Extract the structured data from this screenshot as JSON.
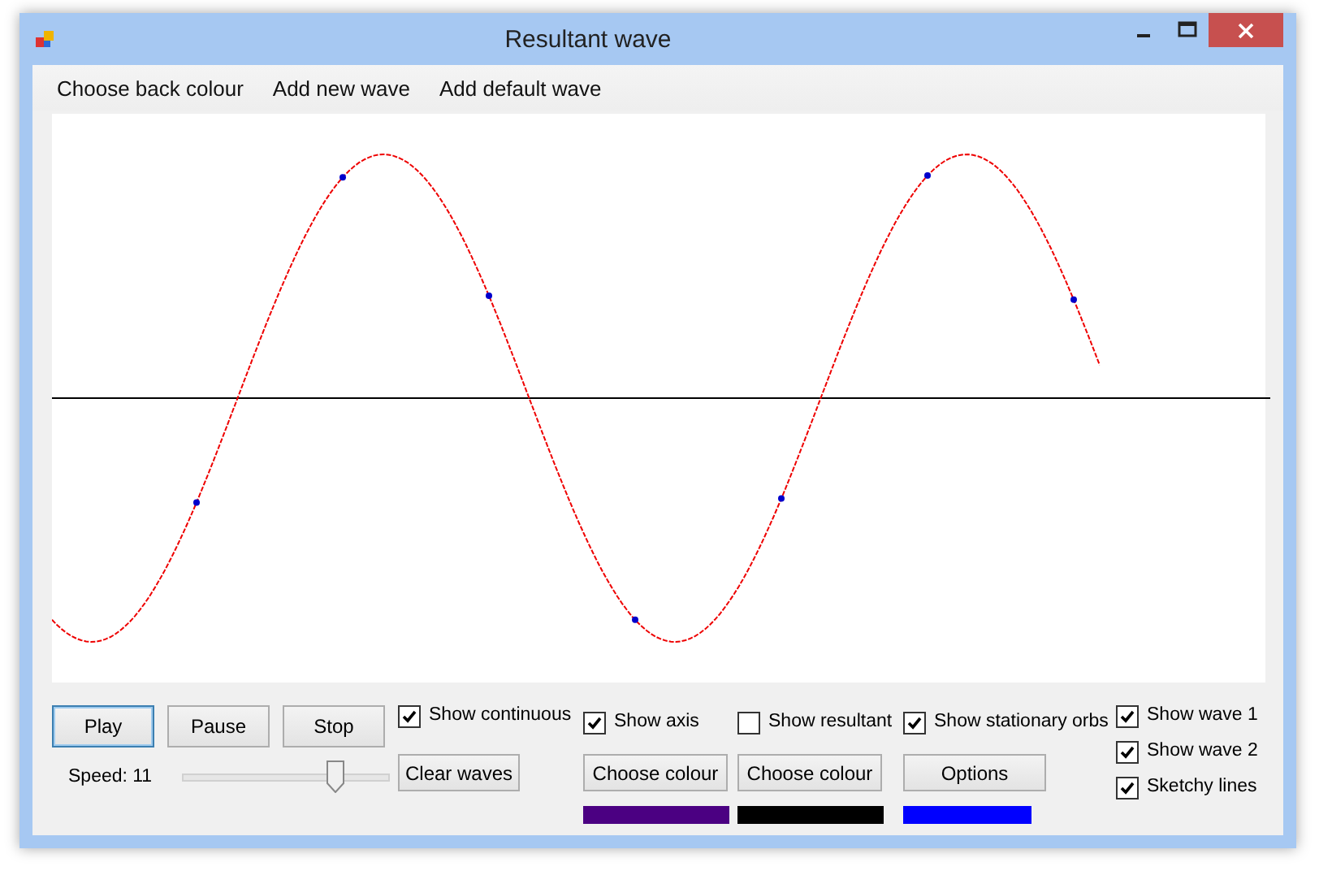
{
  "window": {
    "title": "Resultant wave"
  },
  "menu": [
    "Choose back colour",
    "Add new wave",
    "Add default wave"
  ],
  "playback_buttons": [
    {
      "label": "Play",
      "focused": true
    },
    {
      "label": "Pause",
      "focused": false
    },
    {
      "label": "Stop",
      "focused": false
    }
  ],
  "speed": {
    "label": "Speed: 11",
    "level": 0.74
  },
  "show_continuous": {
    "label": "Show continuous",
    "checked": true
  },
  "clear_waves_button": "Clear waves",
  "layers": [
    {
      "label": "Show axis",
      "checked": true,
      "button": "Choose  colour",
      "color": "#4b0082"
    },
    {
      "label": "Show resultant",
      "checked": false,
      "button": "Choose colour",
      "color": "#000000"
    },
    {
      "label": "Show stationary orbs",
      "checked": true,
      "button": "Options",
      "color": "#0000ff"
    }
  ],
  "wave_toggles": [
    {
      "label": "Show wave 1",
      "checked": true
    },
    {
      "label": "Show wave 2",
      "checked": true
    },
    {
      "label": "Sketchy lines",
      "checked": true
    }
  ]
}
